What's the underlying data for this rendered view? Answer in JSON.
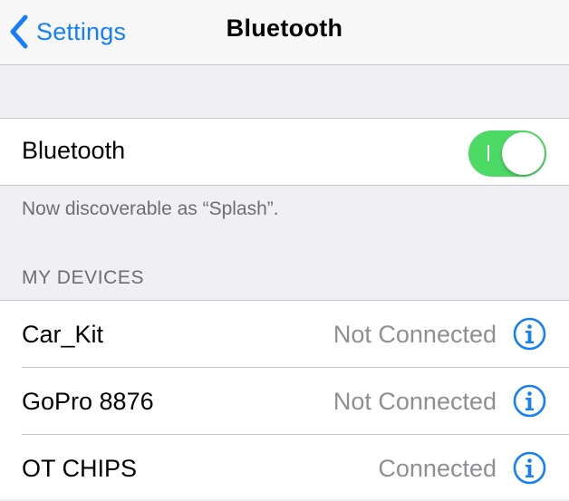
{
  "navbar": {
    "back_label": "Settings",
    "title": "Bluetooth"
  },
  "bluetooth": {
    "label": "Bluetooth",
    "enabled": true
  },
  "discoverable_note": "Now discoverable as “Splash”.",
  "devices": {
    "header": "MY DEVICES",
    "items": [
      {
        "name": "Car_Kit",
        "status": "Not Connected"
      },
      {
        "name": "GoPro 8876",
        "status": "Not Connected"
      },
      {
        "name": "OT CHIPS",
        "status": "Connected"
      }
    ]
  },
  "colors": {
    "accent": "#147efb",
    "toggle_on": "#4cd964",
    "status_gray": "#8e8e93",
    "background": "#efeff4"
  }
}
